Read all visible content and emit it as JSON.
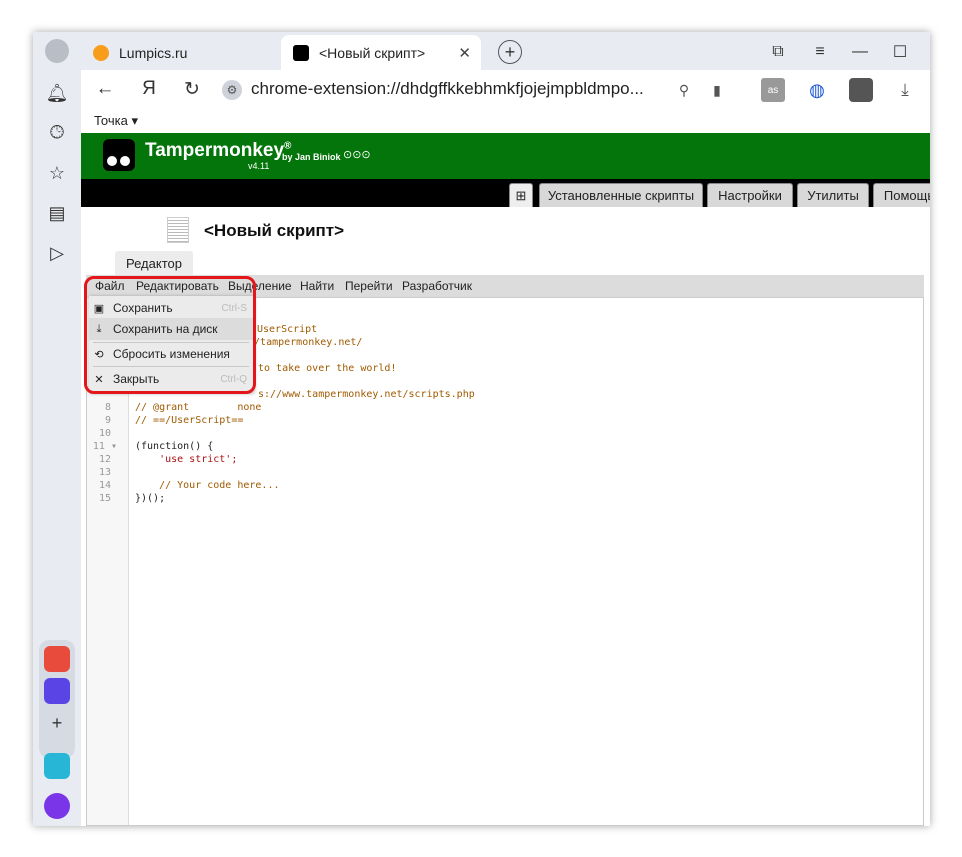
{
  "browser": {
    "tabs": [
      {
        "title": "Lumpics.ru",
        "favicon_color": "#f89c1c"
      },
      {
        "title": "<Новый скрипт>",
        "favicon_color": "#000000"
      }
    ],
    "url": "chrome-extension://dhdgffkkebhmkfjojejmpbldmpo...",
    "bookmark": "Точка ▾",
    "yandex_glyph": "Я"
  },
  "tampermonkey": {
    "title": "Tampermonkey",
    "reg": "®",
    "by": "by Jan Biniok",
    "version": "v4.11",
    "nav_tabs": [
      "Установленные скрипты",
      "Настройки",
      "Утилиты",
      "Помощь"
    ],
    "add_tab": "⊞"
  },
  "editor": {
    "script_title": "<Новый скрипт>",
    "tab_label": "Редактор",
    "menu": [
      "Файл",
      "Редактировать",
      "Выделение",
      "Найти",
      "Перейти",
      "Разработчик"
    ],
    "line_numbers": [
      "8",
      "9",
      "10",
      "11 ▾",
      "12",
      "13",
      "14",
      "15"
    ],
    "visible_code_fragments": [
      "UserScript",
      "://tampermonkey.net/",
      "to take over the world!",
      "s://www.tampermonkey.net/scripts.php"
    ],
    "code_lines": [
      "// @grant        none",
      "// ==/UserScript==",
      "",
      "(function() {",
      "    'use strict';",
      "",
      "    // Your code here...",
      "})();"
    ]
  },
  "file_menu": {
    "items": [
      {
        "label": "Сохранить",
        "icon": "💾",
        "shortcut": "Ctrl-S"
      },
      {
        "label": "Сохранить на диск",
        "icon": "⤓",
        "shortcut": ""
      },
      {
        "label": "Сбросить изменения",
        "icon": "⟲",
        "shortcut": ""
      },
      {
        "label": "Закрыть",
        "icon": "✕",
        "shortcut": "Ctrl-Q"
      }
    ],
    "highlight_color": "#e3161a"
  }
}
